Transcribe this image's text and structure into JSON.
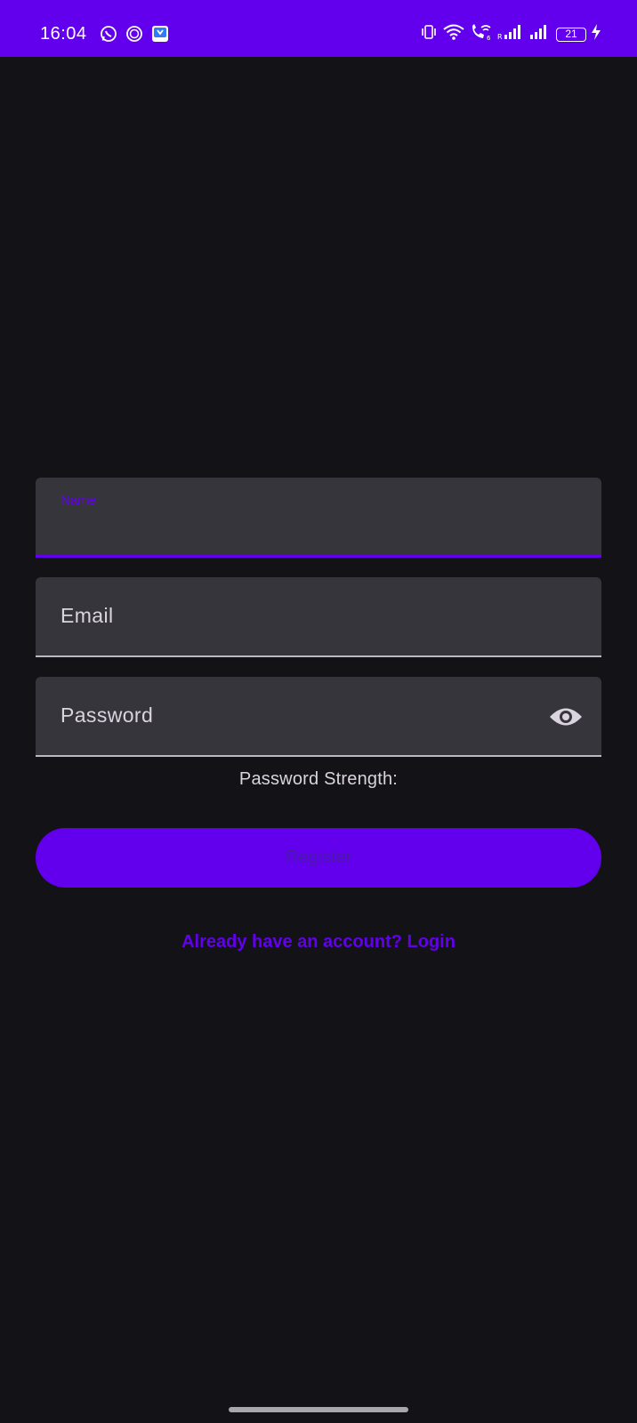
{
  "status_bar": {
    "time": "16:04",
    "battery_level": "21",
    "left_icons": [
      "whatsapp-icon",
      "s-circle-icon",
      "app-store-icon"
    ],
    "right_icons": [
      "vibrate-icon",
      "wifi-icon",
      "wifi-calling-icon",
      "signal-r-icon",
      "signal-icon",
      "battery-icon",
      "charging-icon"
    ]
  },
  "form": {
    "name_label": "Name",
    "email_label": "Email",
    "password_label": "Password",
    "password_strength_label": "Password Strength:",
    "register_button": "Register",
    "login_link": "Already have an account? Login"
  },
  "colors": {
    "accent": "#6200ee",
    "background": "#131217",
    "field_background": "#37353c"
  }
}
